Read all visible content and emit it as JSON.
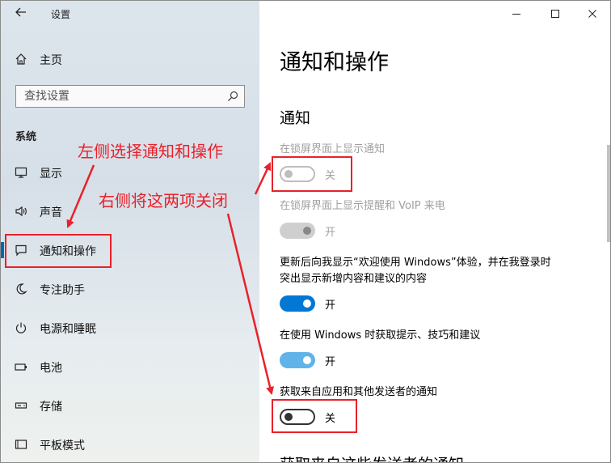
{
  "window": {
    "title": "设置"
  },
  "sidebar": {
    "home_label": "主页",
    "search_placeholder": "查找设置",
    "section_label": "系统",
    "items": [
      {
        "label": "显示",
        "icon": "monitor-icon"
      },
      {
        "label": "声音",
        "icon": "speaker-icon"
      },
      {
        "label": "通知和操作",
        "icon": "notification-icon",
        "selected": true
      },
      {
        "label": "专注助手",
        "icon": "moon-icon"
      },
      {
        "label": "电源和睡眠",
        "icon": "power-icon"
      },
      {
        "label": "电池",
        "icon": "battery-icon"
      },
      {
        "label": "存储",
        "icon": "storage-icon"
      },
      {
        "label": "平板模式",
        "icon": "tablet-icon"
      }
    ]
  },
  "content": {
    "page_title": "通知和操作",
    "group_title": "通知",
    "settings": [
      {
        "label": "在锁屏界面上显示通知",
        "state": "关",
        "on": false,
        "disabled": true
      },
      {
        "label": "在锁屏界面上显示提醒和 VoIP 来电",
        "state": "开",
        "on": true,
        "disabled": true
      },
      {
        "label_line1": "更新后向我显示“欢迎使用 Windows”体验，并在我登录时",
        "label_line2": "突出显示新增内容和建议的内容",
        "state": "开",
        "on": true,
        "disabled": false
      },
      {
        "label": "在使用 Windows 时获取提示、技巧和建议",
        "state": "开",
        "on": true,
        "disabled": false
      },
      {
        "label": "获取来自应用和其他发送者的通知",
        "state": "关",
        "on": false,
        "disabled": false
      }
    ],
    "cut_off_text": "获取来自这些发送者的通知"
  },
  "annotations": {
    "left_note": "左侧选择通知和操作",
    "right_note": "右侧将这两项关闭",
    "color": "#e8212b"
  },
  "colors": {
    "accent": "#0078d4",
    "annotation": "#e8212b"
  }
}
